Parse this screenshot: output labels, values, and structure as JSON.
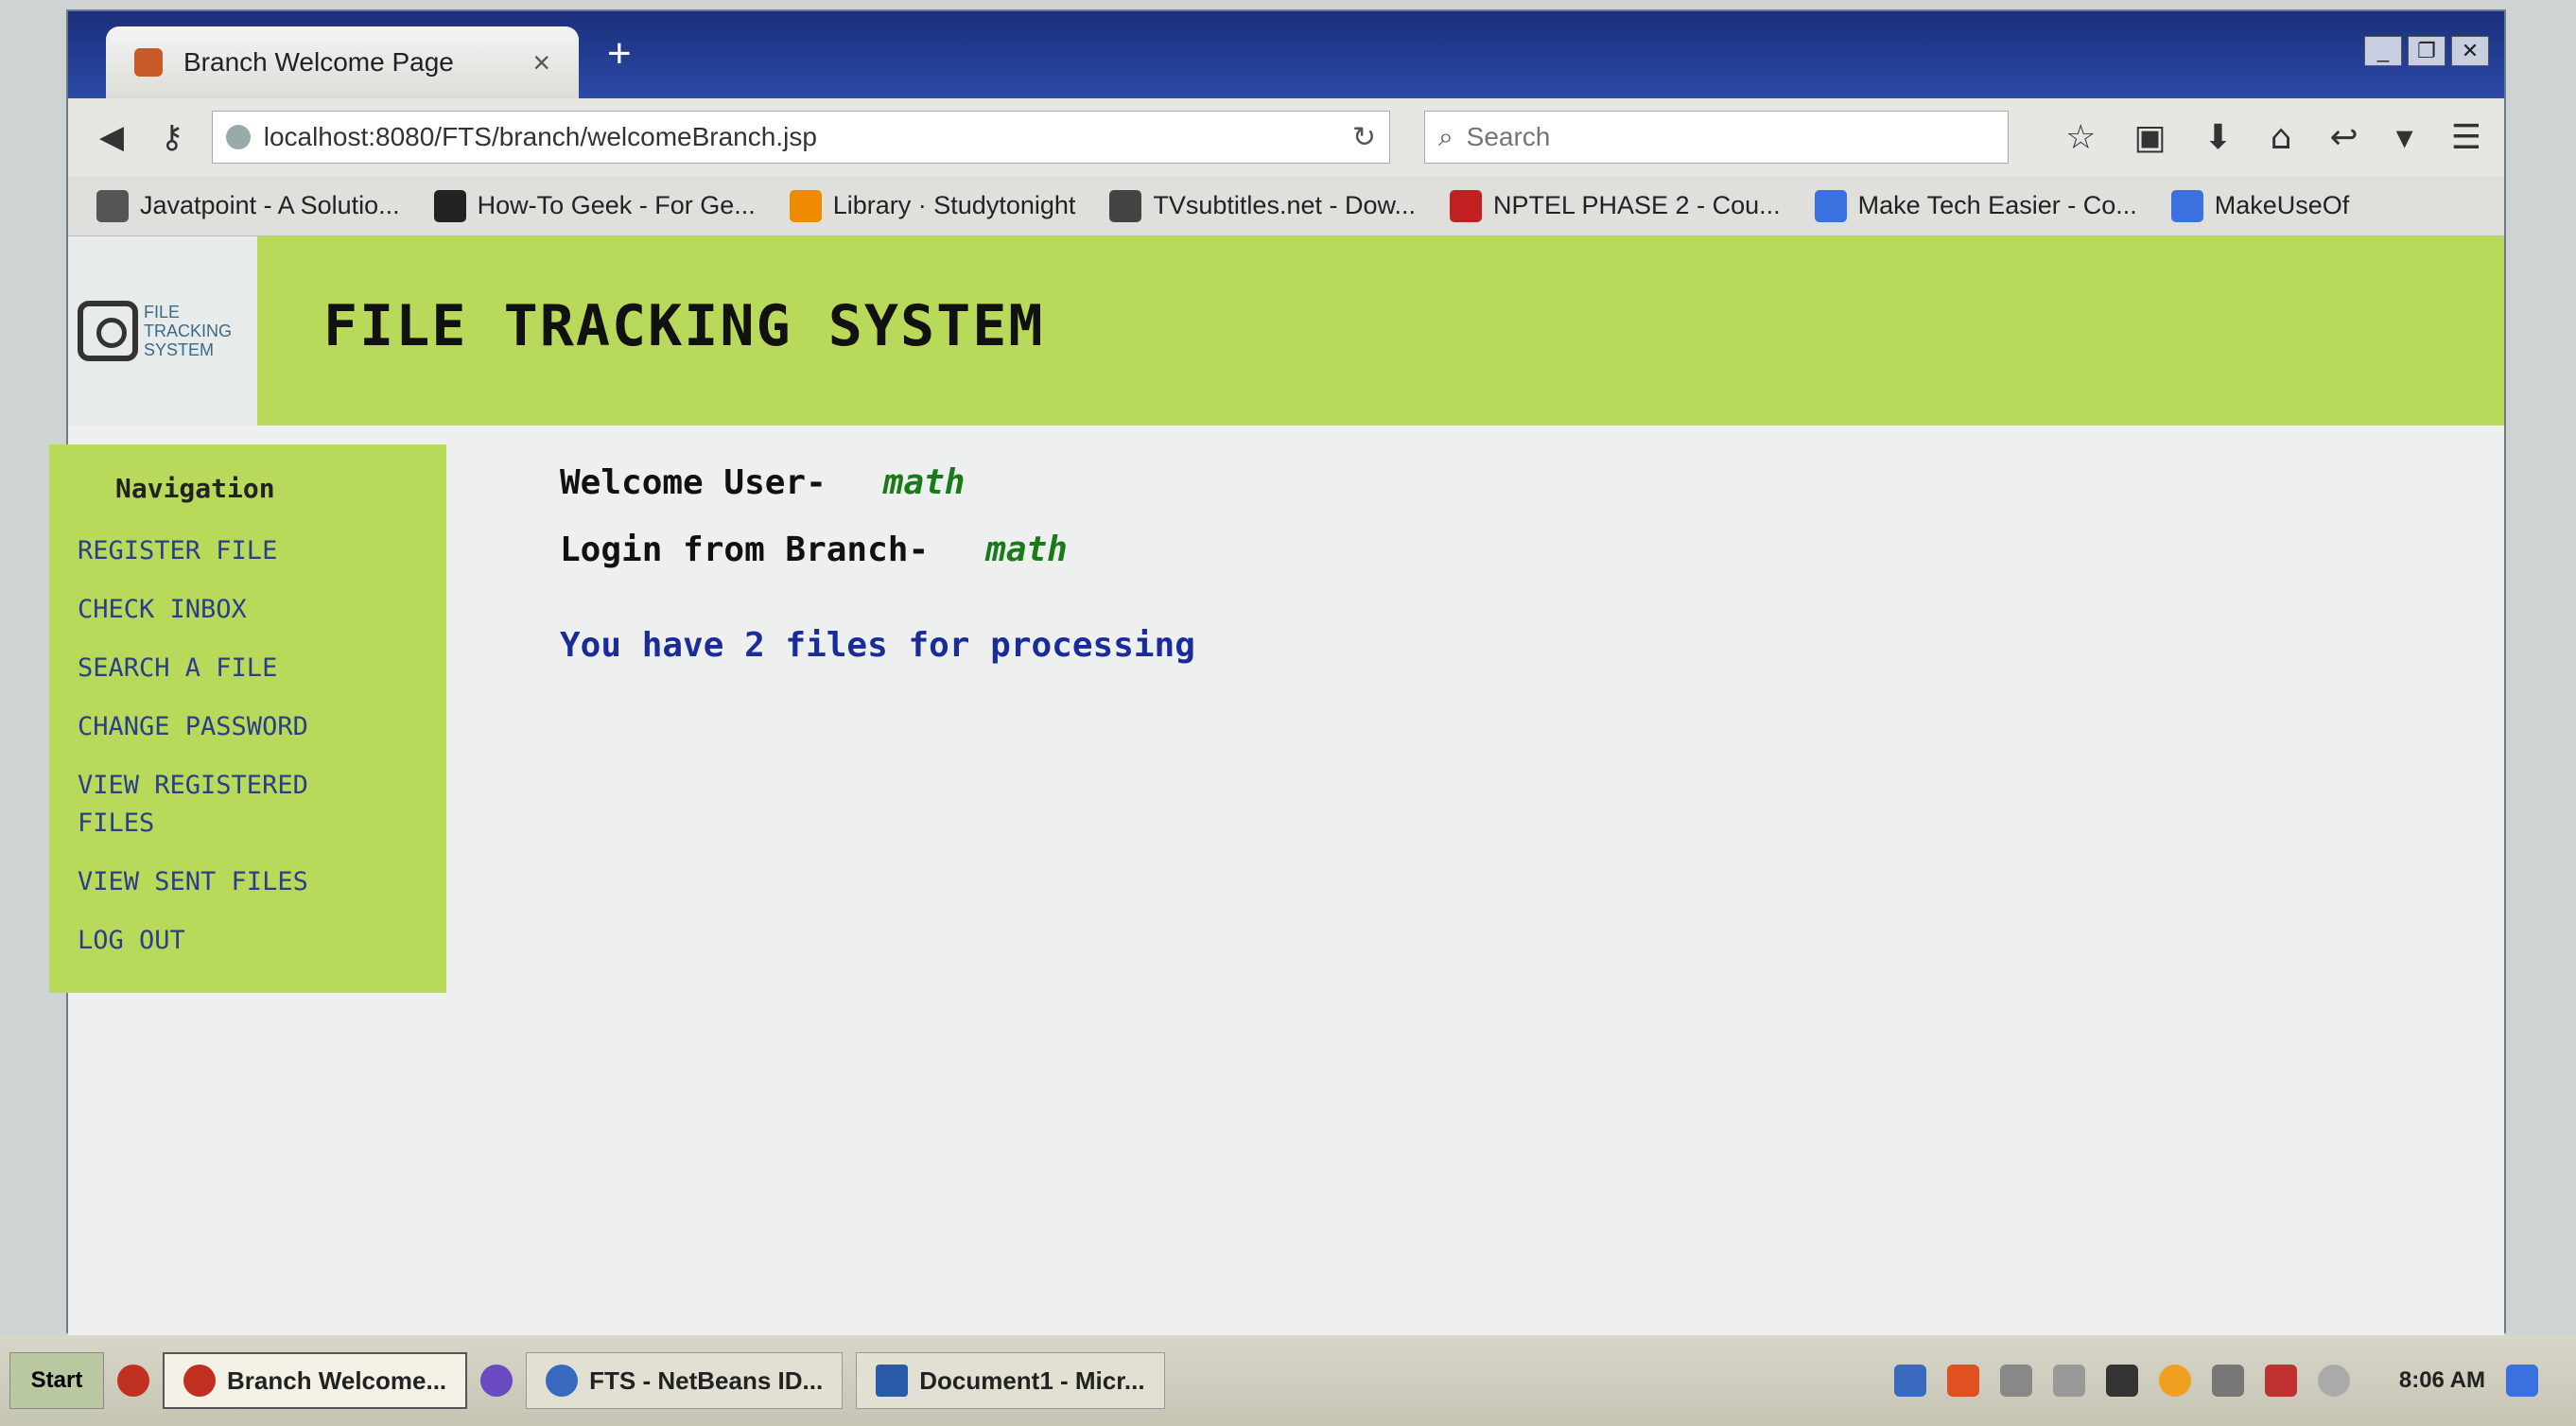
{
  "browser": {
    "tab_title": "Branch Welcome Page",
    "tab_close": "×",
    "new_tab": "+",
    "window_controls": [
      "_",
      "❐",
      "✕"
    ],
    "url": "localhost:8080/FTS/branch/welcomeBranch.jsp",
    "search_placeholder": "Search",
    "bookmarks": [
      {
        "label": "Javatpoint - A Solutio...",
        "color": "#555555"
      },
      {
        "label": "How-To Geek - For Ge...",
        "color": "#222222"
      },
      {
        "label": "Library · Studytonight",
        "color": "#f08a00"
      },
      {
        "label": "TVsubtitles.net - Dow...",
        "color": "#444444"
      },
      {
        "label": "NPTEL PHASE 2 - Cou...",
        "color": "#c02020"
      },
      {
        "label": "Make Tech Easier - Co...",
        "color": "#3a70e0"
      },
      {
        "label": "MakeUseOf",
        "color": "#3a70e0"
      }
    ]
  },
  "site": {
    "logo_text": "FILE TRACKING SYSTEM",
    "title": "FILE TRACKING SYSTEM",
    "nav_heading": "Navigation",
    "nav": [
      "REGISTER FILE",
      "CHECK INBOX",
      "SEARCH A FILE",
      "CHANGE PASSWORD",
      "VIEW REGISTERED FILES",
      "VIEW SENT FILES",
      "LOG OUT"
    ],
    "welcome_label": "Welcome User-",
    "welcome_user": "math",
    "branch_label": "Login from Branch-",
    "branch_name": "math",
    "notice": "You have 2 files for processing"
  },
  "taskbar": {
    "start": "Start",
    "tasks": [
      {
        "label": "Branch Welcome...",
        "active": true,
        "color": "#c03020"
      },
      {
        "label": "FTS - NetBeans ID...",
        "active": false,
        "color": "#3a6ac0"
      },
      {
        "label": "Document1 - Micr...",
        "active": false,
        "color": "#2a5aa8"
      }
    ],
    "clock": "8:06 AM"
  },
  "colors": {
    "header_green": "#b8d95a",
    "link_blue": "#2a3f8a",
    "value_green": "#1a7a1a",
    "notice_blue": "#1a2c9a"
  }
}
